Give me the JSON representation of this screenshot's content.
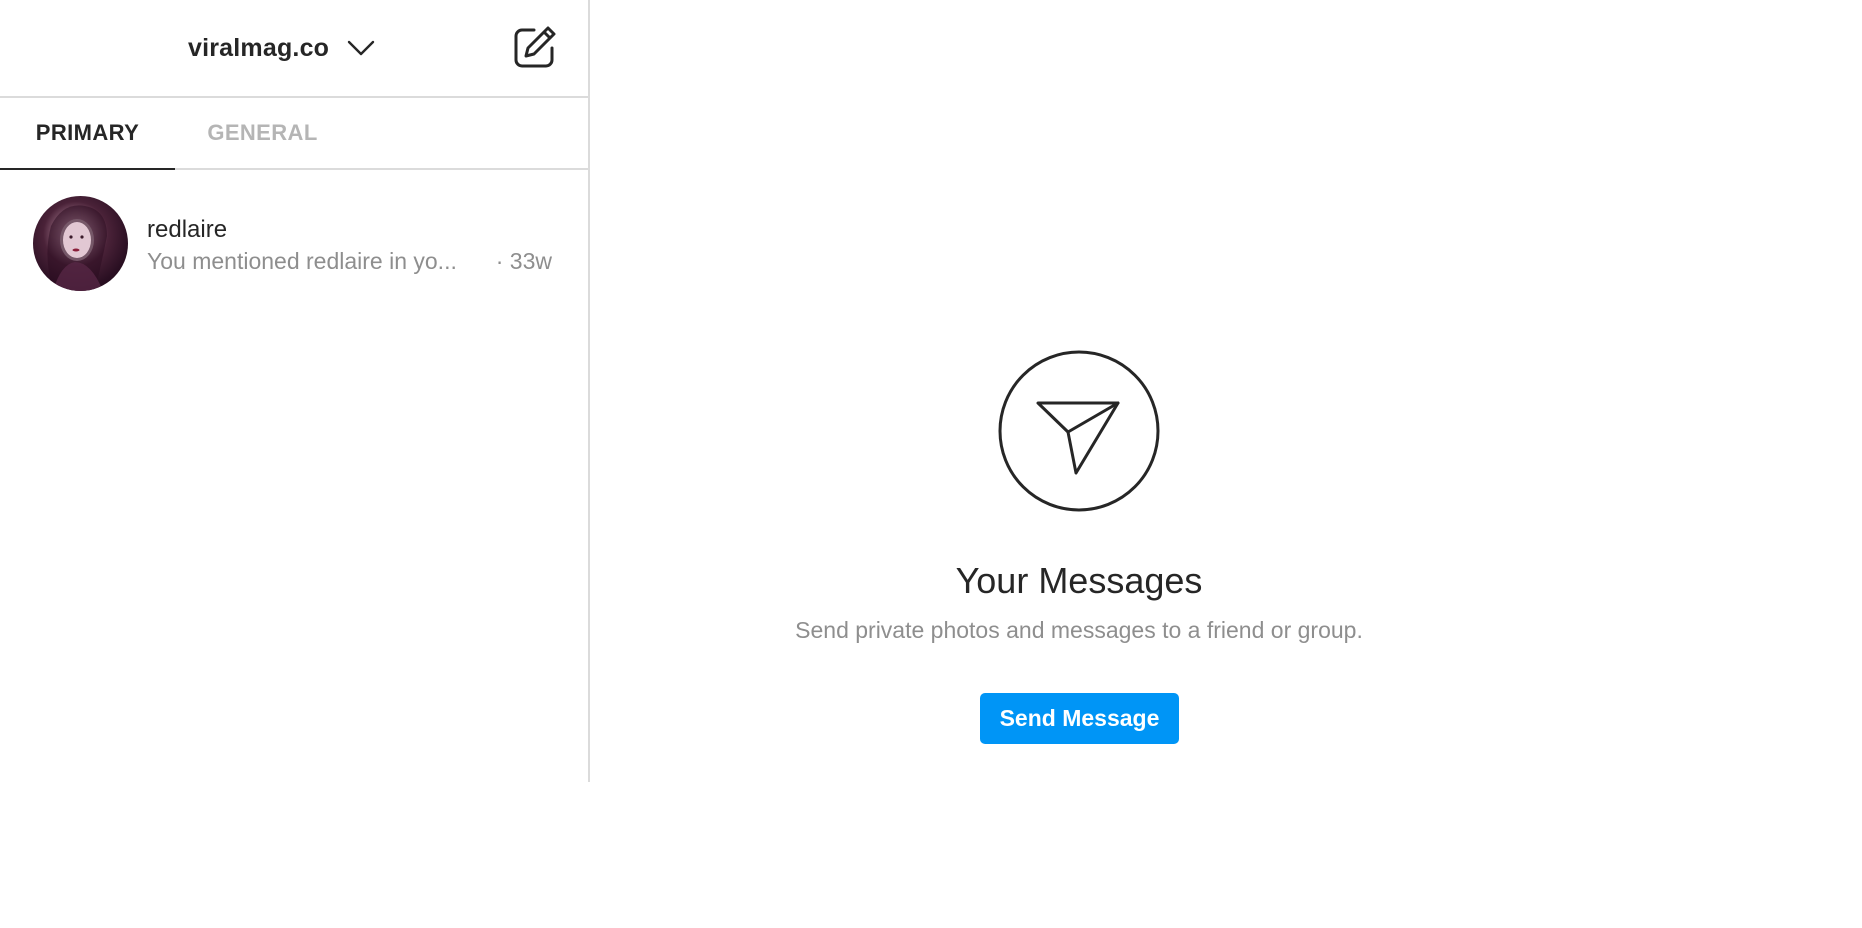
{
  "header": {
    "account_name": "viralmag.co",
    "chevron_icon": "chevron-down-icon",
    "compose_icon": "edit-icon"
  },
  "tabs": [
    {
      "label": "PRIMARY",
      "active": true
    },
    {
      "label": "GENERAL",
      "active": false
    }
  ],
  "threads": [
    {
      "name": "redlaire",
      "preview": "You mentioned redlaire in yo...",
      "time": "· 33w",
      "avatar": "avatar-photo"
    }
  ],
  "empty_state": {
    "icon": "paper-plane-icon",
    "title": "Your Messages",
    "subtitle": "Send private photos and messages to a friend or group.",
    "button_label": "Send Message"
  },
  "colors": {
    "accent": "#0095f6",
    "text_primary": "#262626",
    "text_secondary": "#8e8e8e",
    "border": "#dbdbdb",
    "tab_inactive": "#b5b5b5"
  }
}
